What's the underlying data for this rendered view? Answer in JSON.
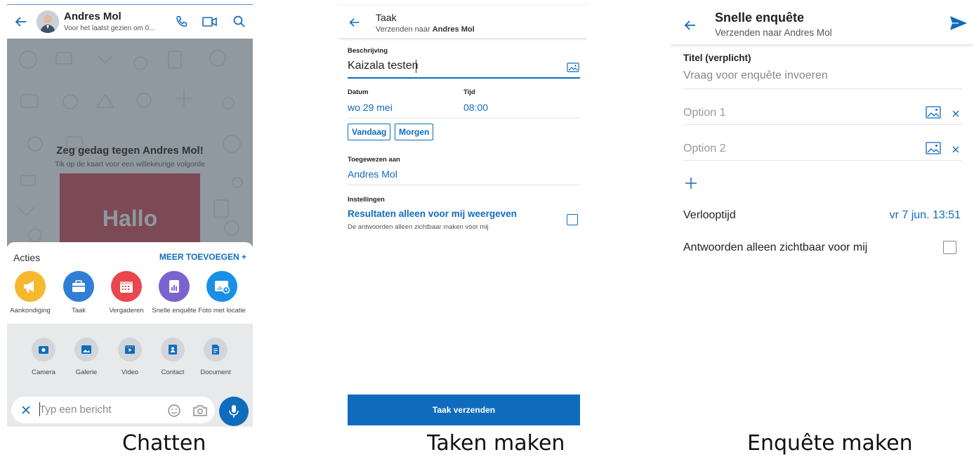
{
  "chat": {
    "contact_name": "Andres Mol",
    "last_seen": "Voor het laatst gezien om 0...",
    "greeting": "Zeg gedag tegen Andres Mol!",
    "greeting_hint": "Tik op de kaart voor een willekeurige volgorde",
    "card_text": "Hallo",
    "actions_title": "Acties",
    "add_more": "MEER TOEVOEGEN +",
    "actions": [
      {
        "label": "Aankondiging",
        "icon": "megaphone-icon",
        "color": "#f5b82e"
      },
      {
        "label": "Taak",
        "icon": "briefcase-icon",
        "color": "#2f7fd6"
      },
      {
        "label": "Vergaderen",
        "icon": "calendar-icon",
        "color": "#e8474c"
      },
      {
        "label": "Snelle enquête",
        "icon": "poll-icon",
        "color": "#7a63cf"
      },
      {
        "label": "Foto met locatie",
        "icon": "photo-location-icon",
        "color": "#1a8fe8"
      }
    ],
    "media": [
      {
        "label": "Camera",
        "icon": "camera-icon"
      },
      {
        "label": "Galerie",
        "icon": "gallery-icon"
      },
      {
        "label": "Video",
        "icon": "video-icon"
      },
      {
        "label": "Contact",
        "icon": "contact-icon"
      },
      {
        "label": "Document",
        "icon": "document-icon"
      }
    ],
    "message_placeholder": "Typ een bericht",
    "caption": "Chatten"
  },
  "task": {
    "title": "Taak",
    "send_to_prefix": "Verzenden naar",
    "recipient": "Andres Mol",
    "description_label": "Beschrijving",
    "description_value": "Kaizala testen",
    "date_label": "Datum",
    "date_value": "wo 29 mei",
    "time_label": "Tijd",
    "time_value": "08:00",
    "quick_today": "Vandaag",
    "quick_tomorrow": "Morgen",
    "assigned_label": "Toegewezen aan",
    "assigned_value": "Andres Mol",
    "settings_label": "Instellingen",
    "setting_title": "Resultaten alleen voor mij weergeven",
    "setting_desc": "De antwoorden alleen zichtbaar maken voor mij",
    "setting_checked": false,
    "send_button": "Taak verzenden",
    "caption": "Taken maken"
  },
  "poll": {
    "title": "Snelle enquête",
    "subtitle": "Verzenden naar Andres Mol",
    "title_label": "Titel (verplicht)",
    "question_placeholder": "Vraag voor enquête invoeren",
    "options": [
      {
        "placeholder": "Option 1"
      },
      {
        "placeholder": "Option 2"
      }
    ],
    "expiry_label": "Verlooptijd",
    "expiry_value": "vr 7 jun. 13:51",
    "private_label": "Antwoorden alleen zichtbaar voor mij",
    "private_checked": false,
    "caption": "Enquête maken"
  },
  "colors": {
    "accent": "#0f6cbd",
    "chat_background": "#8f999f",
    "card": "#7c4a54"
  }
}
